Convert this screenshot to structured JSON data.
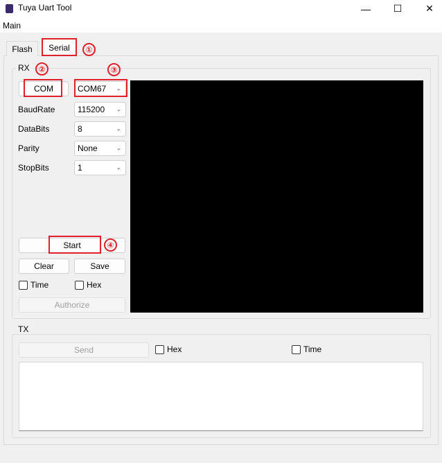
{
  "window": {
    "title": "Tuya Uart Tool",
    "icon": "tuya-app-icon",
    "controls": {
      "minimize": "—",
      "maximize": "☐",
      "close": "✕"
    }
  },
  "menu": {
    "items": [
      "Main"
    ]
  },
  "tabs": [
    {
      "label": "Flash",
      "active": false
    },
    {
      "label": "Serial",
      "active": true
    }
  ],
  "rx": {
    "title": "RX",
    "com_button": "COM",
    "port": {
      "value": "COM67"
    },
    "fields": [
      {
        "label": "BaudRate",
        "value": "115200"
      },
      {
        "label": "DataBits",
        "value": "8"
      },
      {
        "label": "Parity",
        "value": "None"
      },
      {
        "label": "StopBits",
        "value": "1"
      }
    ],
    "start_button": "Start",
    "clear_button": "Clear",
    "save_button": "Save",
    "time_checkbox": {
      "label": "Time",
      "checked": false
    },
    "hex_checkbox": {
      "label": "Hex",
      "checked": false
    },
    "authorize_button": "Authorize"
  },
  "tx": {
    "title": "TX",
    "send_button": "Send",
    "hex_checkbox": {
      "label": "Hex",
      "checked": false
    },
    "time_checkbox": {
      "label": "Time",
      "checked": false
    }
  },
  "annotations": {
    "color": "#e0202a",
    "markers": [
      "①",
      "②",
      "③",
      "④"
    ]
  }
}
